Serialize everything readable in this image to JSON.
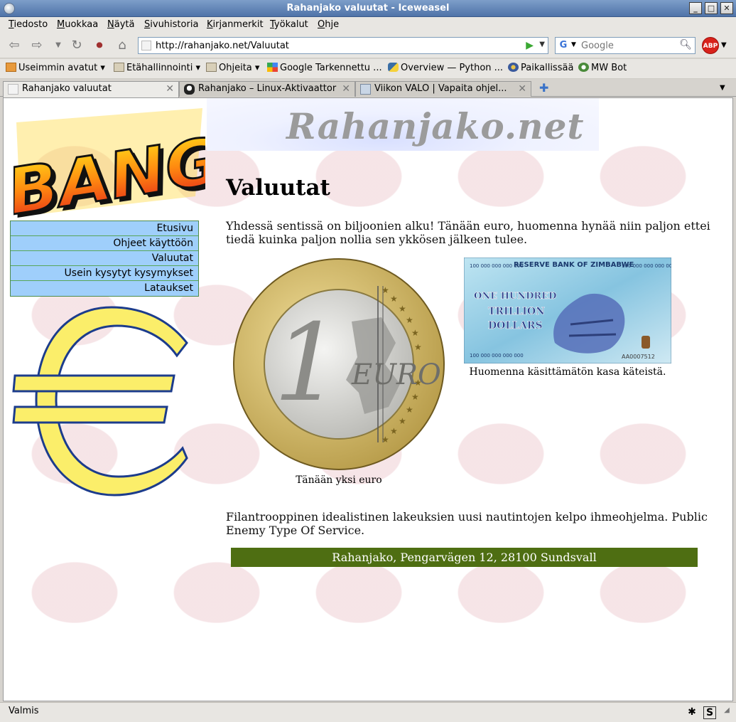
{
  "window": {
    "title": "Rahanjako valuutat - Iceweasel",
    "minimize": "_",
    "maximize": "□",
    "close": "✕"
  },
  "menu": [
    "Tiedosto",
    "Muokkaa",
    "Näytä",
    "Sivuhistoria",
    "Kirjanmerkit",
    "Työkalut",
    "Ohje"
  ],
  "nav": {
    "url": "http://rahanjako.net/Valuutat",
    "search_placeholder": "Google",
    "adblock": "ABP"
  },
  "bookmarks": [
    "Useimmin avatut",
    "Etähallinnointi",
    "Ohjeita",
    "Google Tarkennettu ...",
    "Overview — Python ...",
    "Paikallissää",
    "MW Bot"
  ],
  "tabs": [
    {
      "label": "Rahanjako valuutat",
      "active": true
    },
    {
      "label": "Rahanjako – Linux-Aktivaattori",
      "active": false
    },
    {
      "label": "Viikon VALO | Vapaita ohjel...",
      "active": false
    }
  ],
  "page": {
    "site_title": "Rahanjako.net",
    "logo_text": "BANG",
    "sidebar": [
      "Etusivu",
      "Ohjeet käyttöön",
      "Valuutat",
      "Usein kysytyt kysymykset",
      "Lataukset"
    ],
    "heading": "Valuutat",
    "intro": "Yhdessä sentissä on biljoonien alku! Tänään euro, huomenna hynää niin paljon ettei tiedä kuinka paljon nollia sen ykkösen jälkeen tulee.",
    "coin": {
      "number": "1",
      "text": "EURO",
      "caption": "Tänään yksi euro"
    },
    "banknote": {
      "bank": "RESERVE BANK OF ZIMBABWE",
      "amount_digits": "100 000 000 000 000",
      "line1": "ONE HUNDRED",
      "line2": "TRILLION",
      "line3": "DOLLARS",
      "serial": "AA0007512",
      "caption": "Huomenna käsittämätön kasa käteistä."
    },
    "closing": "Filantrooppinen idealistinen lakeuksien uusi nautintojen kelpo ihmeohjelma. Public Enemy Type Of Service.",
    "footer": "Rahanjako, Pengarvägen 12, 28100 Sundsvall"
  },
  "status": {
    "text": "Valmis"
  },
  "colors": {
    "nav_bg": "#9fcffb",
    "footer_bg": "#4e6e12",
    "euro_yellow": "#fbee6a",
    "euro_outline": "#1c3c8c"
  }
}
